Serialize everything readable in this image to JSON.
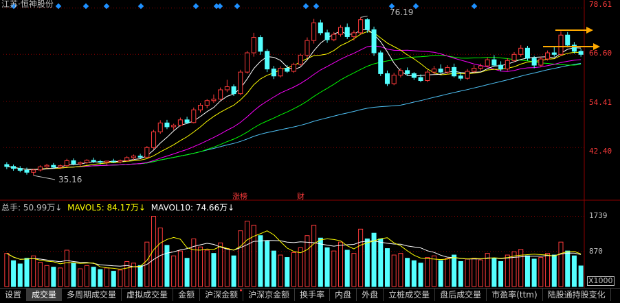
{
  "window_title": "江苏·恒神股份",
  "price_axis": {
    "labels": [
      "78.61",
      "66.60",
      "54.41",
      "42.40"
    ],
    "values": [
      78.61,
      66.6,
      54.41,
      42.4
    ]
  },
  "volume_axis": {
    "labels": [
      "1739",
      "870"
    ],
    "unit": "X1000"
  },
  "annotations": {
    "high": "76.19",
    "low": "35.16",
    "event_a": "涨榜",
    "event_b": "财"
  },
  "volume_legend": {
    "total": "总手: 50.99万↓",
    "mavol5": "MAVOL5: 84.17万↓",
    "mavol10": "MAVOL10: 74.66万↓"
  },
  "tabs": [
    {
      "label": "设置",
      "active": false,
      "dot": false
    },
    {
      "label": "成交量",
      "active": true,
      "dot": false
    },
    {
      "label": "多周期成交量",
      "active": false,
      "dot": false
    },
    {
      "label": "虚拟成交量",
      "active": false,
      "dot": false
    },
    {
      "label": "金额",
      "active": false,
      "dot": false
    },
    {
      "label": "沪深金额",
      "active": false,
      "dot": true
    },
    {
      "label": "沪深京金额",
      "active": false,
      "dot": false
    },
    {
      "label": "换手率",
      "active": false,
      "dot": false
    },
    {
      "label": "内盘",
      "active": false,
      "dot": false
    },
    {
      "label": "外盘",
      "active": false,
      "dot": false
    },
    {
      "label": "立桩成交量",
      "active": false,
      "dot": false
    },
    {
      "label": "盘后成交量",
      "active": false,
      "dot": false
    },
    {
      "label": "市盈率(ttm)",
      "active": false,
      "dot": false
    },
    {
      "label": "陆股通持股变化",
      "active": false,
      "dot": false
    }
  ],
  "colors": {
    "up": "#ff3b3b",
    "down": "#54ffff",
    "ma5": "#ffffff",
    "ma10": "#ffff00",
    "ma20": "#ff00ff",
    "ma30": "#00ff00",
    "ma60": "#4fc3f7",
    "grid": "#8b0000",
    "arrow": "#ffaa00",
    "diamond": "#1e90ff"
  },
  "chart_data": {
    "type": "candlestick",
    "ylim": [
      30,
      80
    ],
    "vol_ylim": [
      0,
      1900
    ],
    "candles": [
      [
        38.0,
        38.6,
        36.8,
        37.5
      ],
      [
        37.5,
        38.0,
        36.4,
        37.0
      ],
      [
        37.0,
        37.6,
        36.0,
        36.5
      ],
      [
        36.5,
        37.2,
        35.4,
        36.0
      ],
      [
        36.0,
        36.8,
        35.16,
        36.6
      ],
      [
        36.6,
        37.8,
        36.2,
        37.4
      ],
      [
        37.4,
        38.2,
        36.9,
        37.8
      ],
      [
        37.8,
        38.4,
        37.0,
        37.3
      ],
      [
        37.3,
        38.0,
        36.8,
        37.7
      ],
      [
        37.7,
        39.5,
        37.4,
        39.0
      ],
      [
        39.0,
        39.6,
        37.8,
        38.2
      ],
      [
        38.2,
        38.8,
        37.5,
        38.5
      ],
      [
        38.5,
        39.4,
        38.0,
        39.1
      ],
      [
        39.1,
        39.8,
        38.4,
        38.8
      ],
      [
        38.8,
        39.2,
        38.0,
        38.6
      ],
      [
        38.6,
        39.0,
        37.9,
        38.9
      ],
      [
        38.9,
        39.5,
        38.4,
        38.7
      ],
      [
        38.7,
        39.3,
        38.3,
        39.0
      ],
      [
        39.0,
        40.2,
        38.8,
        39.8
      ],
      [
        39.8,
        40.6,
        39.2,
        40.2
      ],
      [
        40.2,
        40.8,
        39.6,
        39.9
      ],
      [
        39.9,
        42.8,
        39.8,
        42.4
      ],
      [
        42.4,
        47.0,
        42.0,
        46.5
      ],
      [
        46.5,
        49.5,
        46.0,
        48.8
      ],
      [
        48.8,
        49.6,
        47.2,
        47.8
      ],
      [
        47.8,
        48.6,
        47.0,
        48.2
      ],
      [
        48.2,
        50.2,
        47.9,
        49.6
      ],
      [
        49.6,
        50.4,
        48.6,
        48.9
      ],
      [
        48.9,
        52.8,
        48.7,
        52.2
      ],
      [
        52.2,
        54.0,
        51.5,
        53.4
      ],
      [
        53.4,
        55.0,
        52.6,
        54.6
      ],
      [
        54.6,
        56.2,
        54.0,
        55.0
      ],
      [
        55.0,
        58.0,
        54.7,
        57.4
      ],
      [
        57.4,
        60.0,
        56.8,
        58.2
      ],
      [
        58.2,
        58.8,
        55.8,
        56.4
      ],
      [
        56.4,
        62.6,
        56.0,
        62.0
      ],
      [
        62.0,
        67.5,
        61.6,
        67.0
      ],
      [
        67.0,
        72.2,
        66.0,
        71.0
      ],
      [
        71.0,
        71.6,
        66.5,
        67.4
      ],
      [
        67.4,
        68.0,
        62.0,
        62.8
      ],
      [
        62.8,
        63.6,
        60.2,
        61.0
      ],
      [
        61.0,
        63.5,
        60.6,
        63.0
      ],
      [
        63.0,
        63.8,
        61.8,
        62.2
      ],
      [
        62.2,
        64.4,
        61.8,
        64.0
      ],
      [
        64.0,
        66.8,
        63.6,
        66.4
      ],
      [
        66.4,
        71.0,
        65.6,
        70.2
      ],
      [
        70.2,
        75.8,
        69.4,
        74.8
      ],
      [
        74.8,
        75.6,
        71.6,
        72.2
      ],
      [
        72.2,
        73.0,
        69.6,
        70.4
      ],
      [
        70.4,
        72.4,
        70.0,
        71.8
      ],
      [
        71.8,
        74.2,
        71.2,
        73.6
      ],
      [
        73.6,
        74.6,
        70.6,
        71.2
      ],
      [
        71.2,
        72.8,
        70.2,
        72.2
      ],
      [
        72.2,
        76.19,
        71.8,
        75.6
      ],
      [
        75.6,
        76.0,
        72.2,
        73.0
      ],
      [
        73.0,
        73.8,
        66.2,
        67.0
      ],
      [
        67.0,
        67.6,
        61.0,
        61.6
      ],
      [
        61.6,
        62.4,
        58.4,
        59.0
      ],
      [
        59.0,
        61.8,
        58.6,
        61.2
      ],
      [
        61.2,
        63.0,
        60.6,
        62.4
      ],
      [
        62.4,
        63.2,
        61.0,
        61.6
      ],
      [
        61.6,
        62.0,
        60.0,
        60.6
      ],
      [
        60.6,
        61.4,
        59.4,
        59.8
      ],
      [
        59.8,
        62.6,
        59.4,
        62.0
      ],
      [
        62.0,
        63.6,
        61.4,
        62.8
      ],
      [
        62.8,
        64.0,
        61.6,
        62.0
      ],
      [
        62.0,
        63.8,
        61.4,
        63.2
      ],
      [
        63.2,
        64.2,
        60.6,
        61.0
      ],
      [
        61.0,
        62.0,
        59.8,
        60.4
      ],
      [
        60.4,
        62.8,
        60.0,
        62.2
      ],
      [
        62.2,
        63.8,
        61.8,
        63.0
      ],
      [
        63.0,
        64.2,
        62.4,
        63.6
      ],
      [
        63.6,
        65.8,
        63.2,
        65.2
      ],
      [
        65.2,
        66.4,
        63.4,
        63.8
      ],
      [
        63.8,
        64.8,
        62.2,
        62.8
      ],
      [
        62.8,
        65.6,
        62.4,
        65.0
      ],
      [
        65.0,
        67.2,
        64.6,
        66.6
      ],
      [
        66.6,
        69.0,
        66.0,
        68.2
      ],
      [
        68.2,
        68.8,
        65.0,
        65.6
      ],
      [
        65.6,
        66.2,
        63.0,
        63.8
      ],
      [
        63.8,
        66.0,
        63.4,
        65.4
      ],
      [
        65.4,
        67.6,
        65.0,
        67.0
      ],
      [
        67.0,
        68.6,
        66.0,
        66.6
      ],
      [
        66.6,
        72.6,
        66.2,
        71.6
      ],
      [
        71.6,
        72.4,
        68.4,
        69.0
      ],
      [
        69.0,
        69.8,
        66.8,
        67.4
      ],
      [
        67.4,
        68.0,
        66.0,
        66.6
      ]
    ],
    "volumes": [
      [
        820,
        1
      ],
      [
        640,
        0
      ],
      [
        560,
        0
      ],
      [
        700,
        0
      ],
      [
        760,
        1
      ],
      [
        600,
        1
      ],
      [
        520,
        1
      ],
      [
        480,
        0
      ],
      [
        460,
        1
      ],
      [
        900,
        1
      ],
      [
        580,
        0
      ],
      [
        440,
        1
      ],
      [
        520,
        1
      ],
      [
        480,
        0
      ],
      [
        420,
        0
      ],
      [
        460,
        1
      ],
      [
        380,
        0
      ],
      [
        410,
        1
      ],
      [
        620,
        1
      ],
      [
        580,
        1
      ],
      [
        520,
        0
      ],
      [
        1100,
        1
      ],
      [
        1739,
        1
      ],
      [
        1450,
        1
      ],
      [
        1020,
        0
      ],
      [
        760,
        1
      ],
      [
        880,
        1
      ],
      [
        700,
        0
      ],
      [
        1180,
        1
      ],
      [
        980,
        1
      ],
      [
        900,
        1
      ],
      [
        820,
        0
      ],
      [
        1080,
        1
      ],
      [
        940,
        1
      ],
      [
        760,
        0
      ],
      [
        1380,
        1
      ],
      [
        1620,
        1
      ],
      [
        1520,
        1
      ],
      [
        1260,
        0
      ],
      [
        1120,
        0
      ],
      [
        880,
        0
      ],
      [
        780,
        1
      ],
      [
        720,
        0
      ],
      [
        840,
        1
      ],
      [
        960,
        1
      ],
      [
        1260,
        1
      ],
      [
        1520,
        1
      ],
      [
        1200,
        0
      ],
      [
        960,
        0
      ],
      [
        880,
        1
      ],
      [
        1100,
        1
      ],
      [
        900,
        0
      ],
      [
        820,
        1
      ],
      [
        1420,
        1
      ],
      [
        1180,
        0
      ],
      [
        1320,
        0
      ],
      [
        1180,
        0
      ],
      [
        940,
        0
      ],
      [
        780,
        1
      ],
      [
        820,
        1
      ],
      [
        700,
        0
      ],
      [
        640,
        0
      ],
      [
        580,
        0
      ],
      [
        720,
        1
      ],
      [
        760,
        1
      ],
      [
        640,
        0
      ],
      [
        700,
        1
      ],
      [
        780,
        0
      ],
      [
        620,
        0
      ],
      [
        680,
        1
      ],
      [
        700,
        1
      ],
      [
        660,
        1
      ],
      [
        820,
        1
      ],
      [
        700,
        0
      ],
      [
        620,
        0
      ],
      [
        780,
        1
      ],
      [
        860,
        1
      ],
      [
        920,
        1
      ],
      [
        760,
        0
      ],
      [
        680,
        0
      ],
      [
        720,
        1
      ],
      [
        820,
        1
      ],
      [
        780,
        0
      ],
      [
        1100,
        1
      ],
      [
        880,
        0
      ],
      [
        760,
        0
      ],
      [
        510,
        0
      ]
    ]
  }
}
